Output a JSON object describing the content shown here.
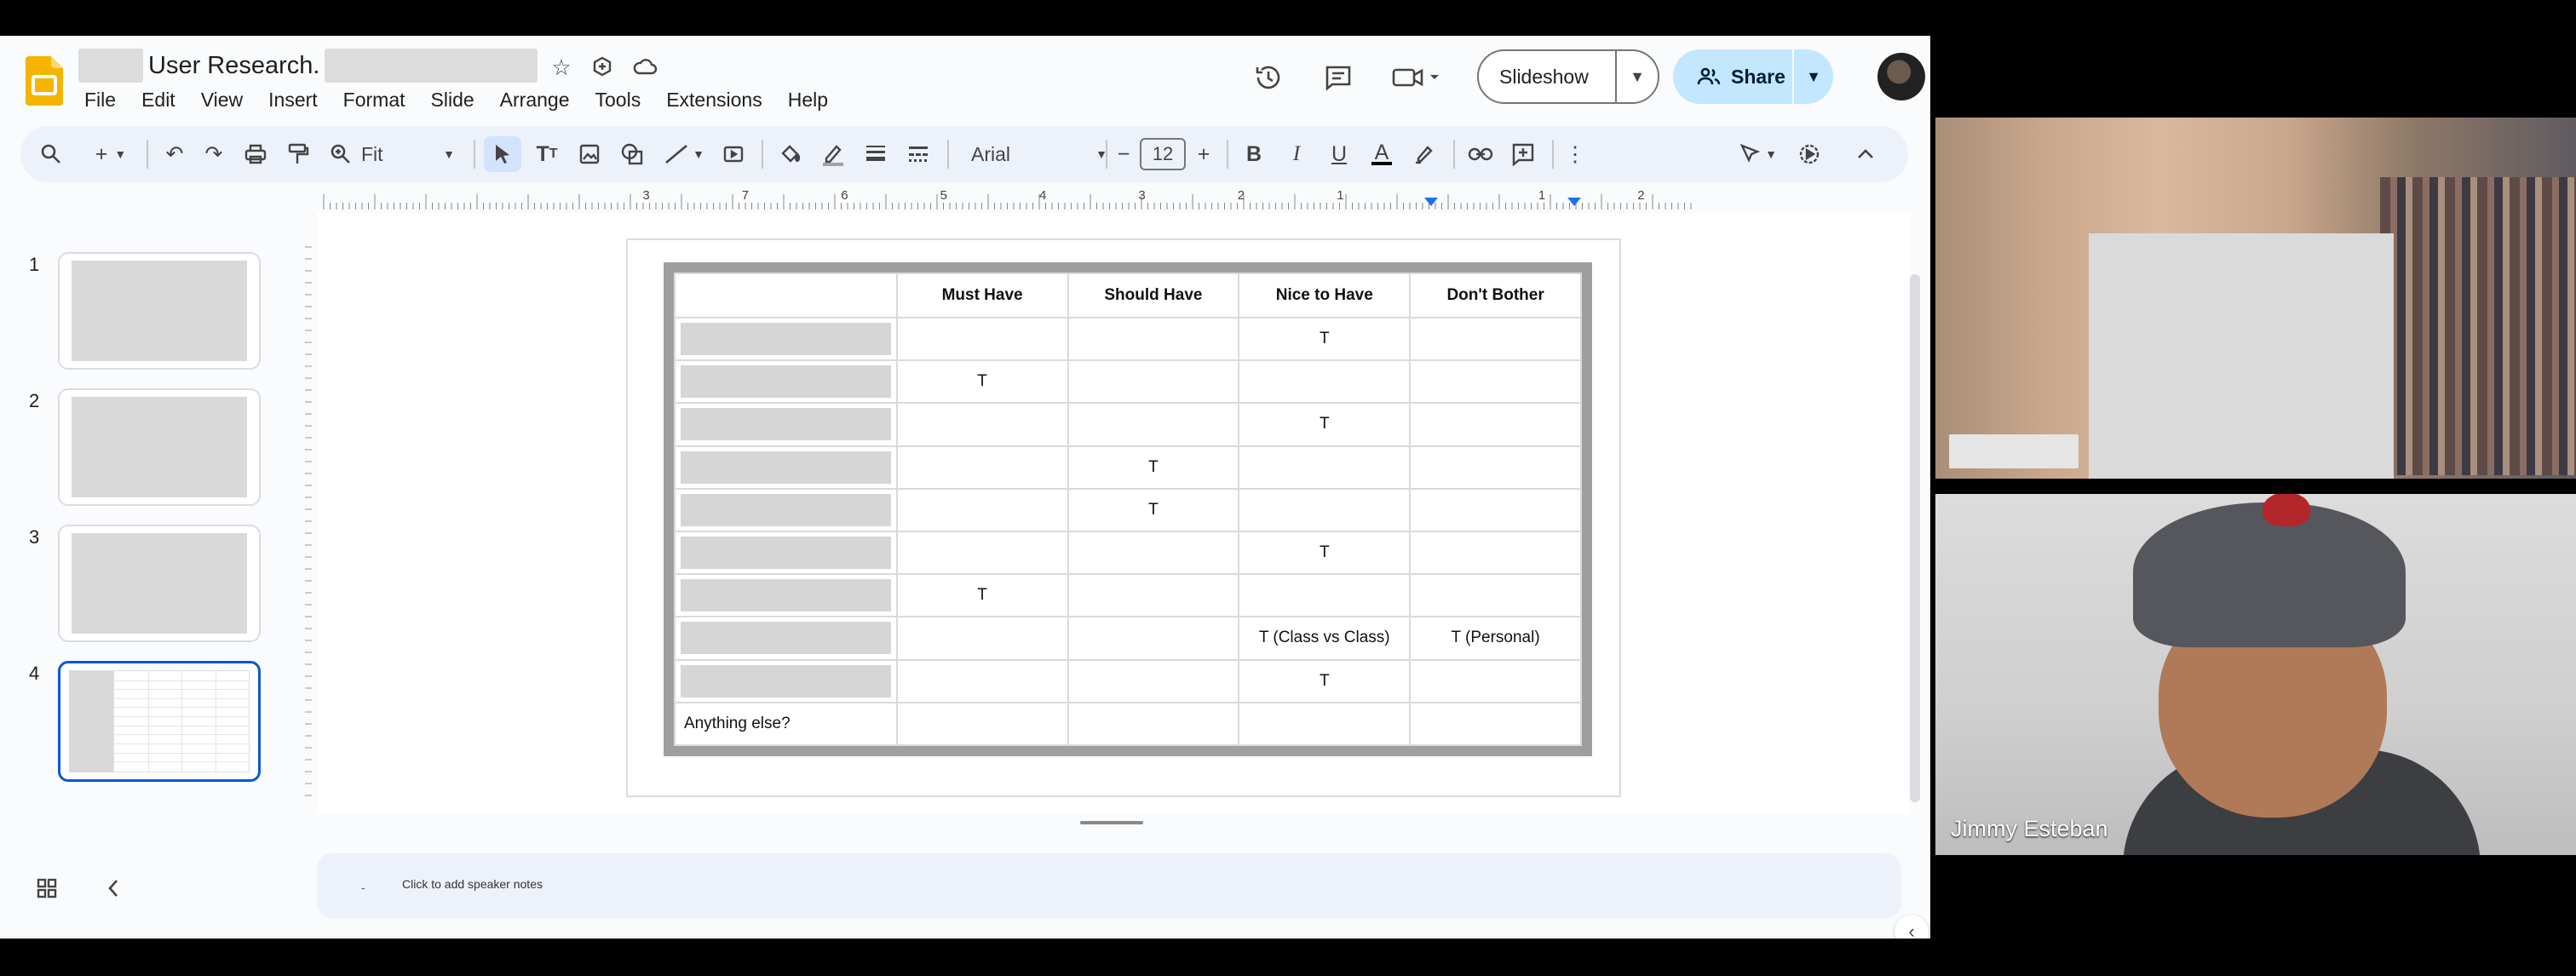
{
  "doc": {
    "title": "User Research.",
    "menu": [
      "File",
      "Edit",
      "View",
      "Insert",
      "Format",
      "Slide",
      "Arrange",
      "Tools",
      "Extensions",
      "Help"
    ]
  },
  "actions": {
    "slideshow_label": "Slideshow",
    "share_label": "Share"
  },
  "toolbar": {
    "zoom": "Fit",
    "font": "Arial",
    "font_size": "12"
  },
  "ruler": {
    "labels": [
      "3",
      "7",
      "6",
      "5",
      "4",
      "3",
      "2",
      "1",
      "1",
      "2"
    ]
  },
  "filmstrip": {
    "slides": [
      "1",
      "2",
      "3",
      "4"
    ],
    "selected": "4"
  },
  "table": {
    "headers": [
      "",
      "Must Have",
      "Should Have",
      "Nice to Have",
      "Don't Bother"
    ],
    "rows": [
      [
        "",
        "",
        "",
        "T",
        ""
      ],
      [
        "",
        "T",
        "",
        "",
        ""
      ],
      [
        "",
        "",
        "",
        "T",
        ""
      ],
      [
        "",
        "",
        "T",
        "",
        ""
      ],
      [
        "",
        "",
        "T",
        "",
        ""
      ],
      [
        "",
        "",
        "",
        "T",
        ""
      ],
      [
        "",
        "T",
        "",
        "",
        ""
      ],
      [
        "",
        "",
        "",
        "T (Class vs Class)",
        "T (Personal)"
      ],
      [
        "",
        "",
        "",
        "T",
        ""
      ],
      [
        "Anything else?",
        "",
        "",
        "",
        ""
      ]
    ]
  },
  "notes": {
    "placeholder": "Click to add speaker notes"
  },
  "video": {
    "participant_name": "Jimmy Esteban"
  },
  "colors": {
    "accent": "#0b57d0",
    "share_bg": "#c2e7ff",
    "app_bg": "#f9fbfd",
    "toolbar_bg": "#edf2fa"
  }
}
